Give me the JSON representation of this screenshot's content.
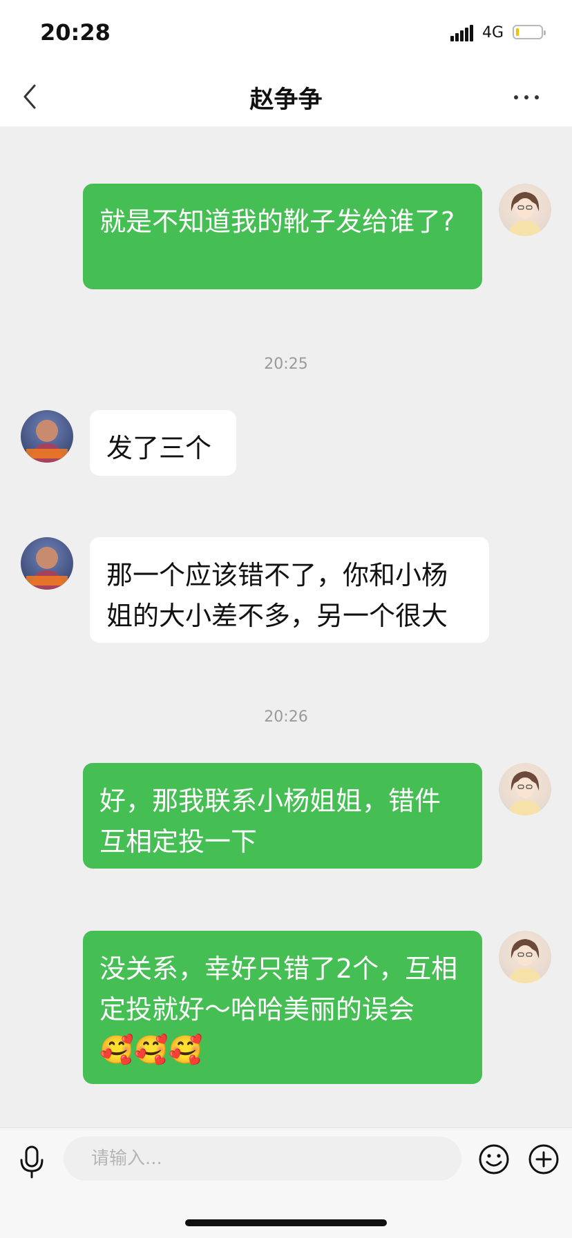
{
  "status_bar": {
    "time": "20:28",
    "network": "4G",
    "battery_level_fraction": 0.1
  },
  "nav": {
    "title": "赵争争",
    "back_icon": "chevron-left-icon",
    "more_icon": "ellipsis-icon"
  },
  "messages": [
    {
      "type": "message",
      "direction": "out",
      "text": "就是不知道我的靴子发给谁了?"
    },
    {
      "type": "timestamp",
      "text": "20:25"
    },
    {
      "type": "message",
      "direction": "in",
      "text": "发了三个"
    },
    {
      "type": "message",
      "direction": "in",
      "text": "那一个应该错不了，你和小杨姐的大小差不多，另一个很大"
    },
    {
      "type": "timestamp",
      "text": "20:26"
    },
    {
      "type": "message",
      "direction": "out",
      "text": "好，那我联系小杨姐姐，错件互相定投一下"
    },
    {
      "type": "message",
      "direction": "out",
      "text": "没关系，幸好只错了2个，互相定投就好～哈哈美丽的误会",
      "emojis": "🥰🥰🥰"
    }
  ],
  "input_bar": {
    "placeholder": "请输入...",
    "mic_icon": "microphone-icon",
    "emoji_icon": "smiley-icon",
    "plus_icon": "plus-circle-icon"
  },
  "colors": {
    "outgoing_bubble": "#45be54",
    "incoming_bubble": "#ffffff",
    "chat_background": "#efefef"
  }
}
